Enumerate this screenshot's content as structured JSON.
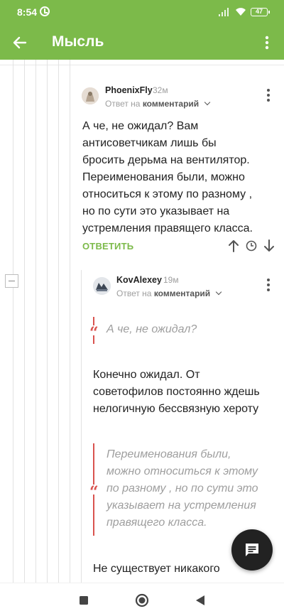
{
  "status_bar": {
    "time": "8:54",
    "battery": "47"
  },
  "app_bar": {
    "title": "Мысль"
  },
  "comments": [
    {
      "author": "PhoenixFly",
      "time": "32м",
      "reply_prefix": "Ответ на",
      "reply_target": "комментарий",
      "text_lines": [
        "А че, не ожидал? Вам",
        "антисоветчикам лишь бы",
        "бросить дерьма на вентилятор.",
        "Переименования были, можно",
        "относиться к этому по разному ,",
        "но по сути это указывает на",
        "устремления правящего класса."
      ],
      "answer_label": "ОТВЕТИТЬ"
    },
    {
      "author": "KovAlexey",
      "time": "19м",
      "reply_prefix": "Ответ на",
      "reply_target": "комментарий",
      "quote1": "А че, не ожидал?",
      "paragraph1_lines": [
        "Конечно ожидал. От",
        "советофилов постоянно ждешь",
        "нелогичную бессвязную хероту"
      ],
      "quote2_lines": [
        "Переименования были,",
        "можно относиться к этому",
        "по разному , но по сути это",
        "указывает на устремления",
        "правящего класса."
      ],
      "paragraph2_line": "Не существует никакого"
    }
  ],
  "colors": {
    "brand": "#7cba4a",
    "quote_accent": "#d9534f",
    "fab": "#222222"
  },
  "icons": {
    "back": "arrow-left-icon",
    "more": "more-vert-icon",
    "up": "arrow-up-icon",
    "down": "arrow-down-icon",
    "clock": "clock-icon",
    "fab": "comments-icon"
  }
}
